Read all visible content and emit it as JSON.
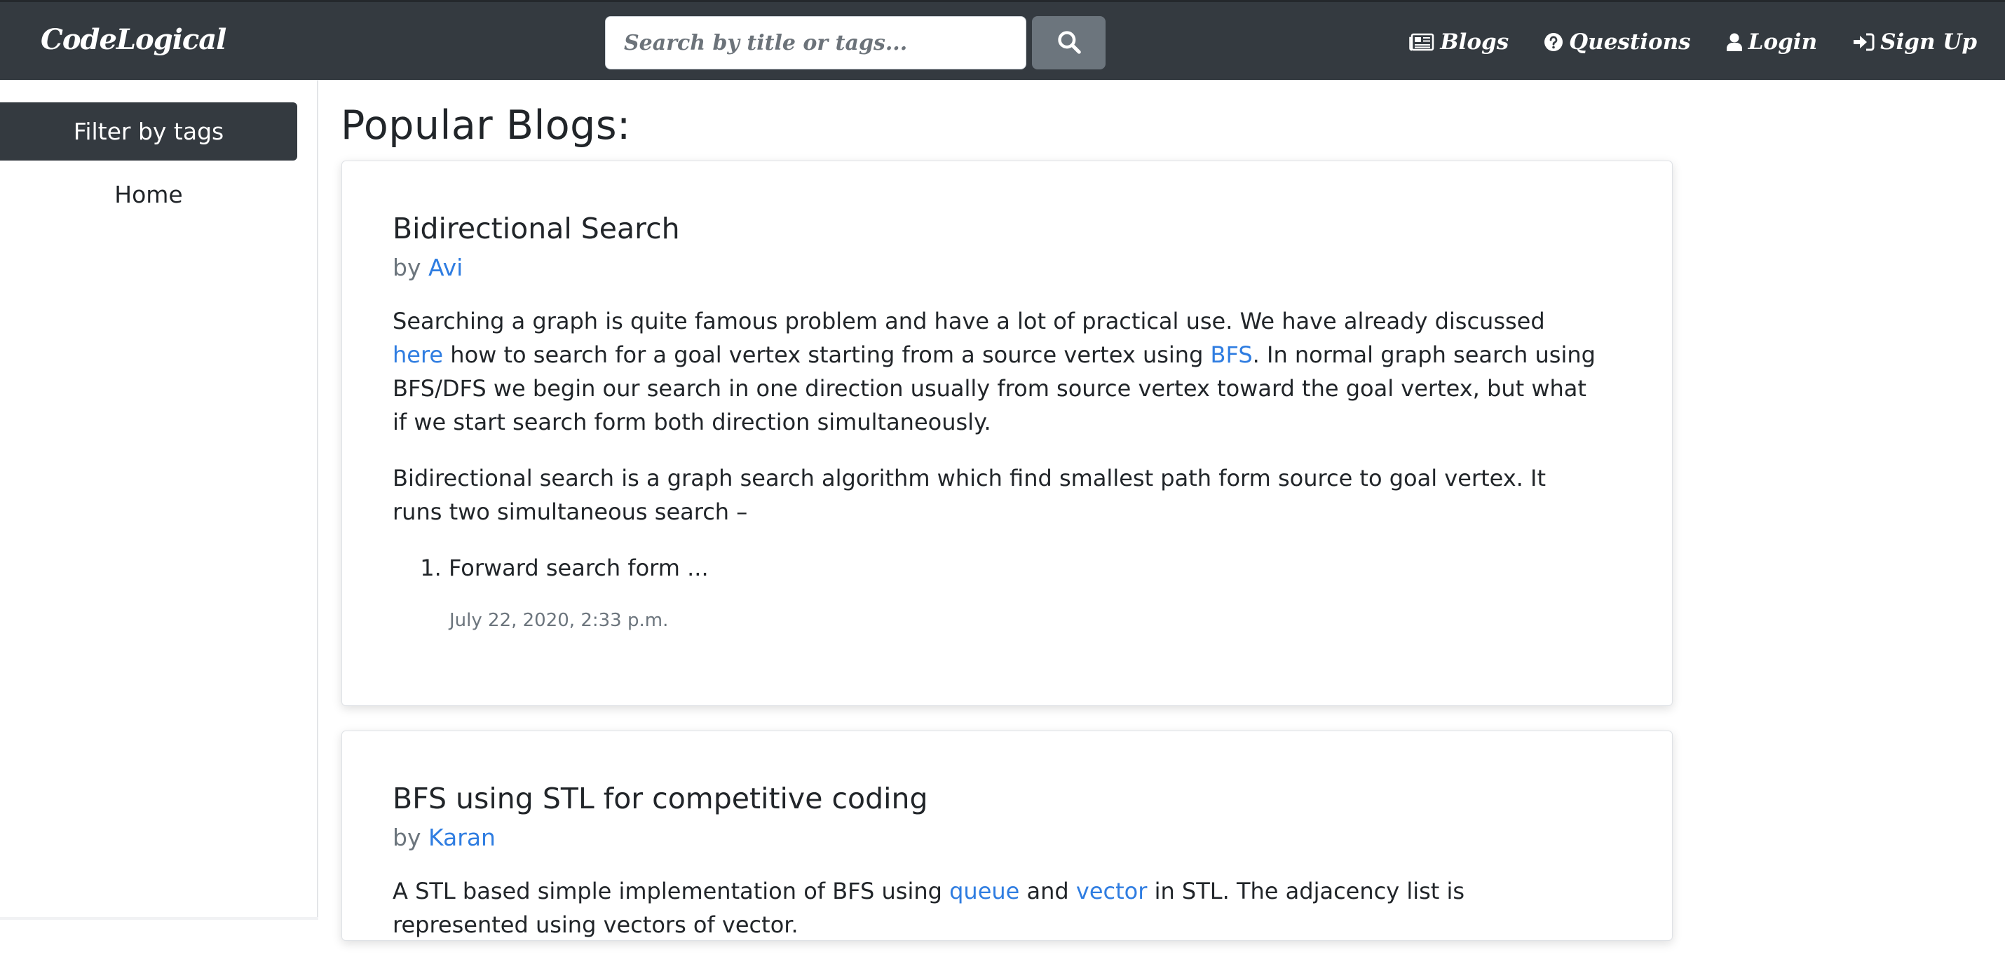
{
  "navbar": {
    "brand": "CodeLogical",
    "search_placeholder": "Search by title or tags...",
    "links": [
      {
        "label": "Blogs",
        "icon": "newspaper-icon"
      },
      {
        "label": "Questions",
        "icon": "question-circle-icon"
      },
      {
        "label": "Login",
        "icon": "user-icon"
      },
      {
        "label": "Sign Up",
        "icon": "sign-in-icon"
      }
    ]
  },
  "sidebar": {
    "filter_label": "Filter by tags",
    "home_label": "Home"
  },
  "main": {
    "title": "Popular Blogs:",
    "posts": [
      {
        "title": "Bidirectional Search",
        "by": "by",
        "author": "Avi",
        "p1_a": "Searching a graph is quite famous problem and have a lot of practical use. We have already discussed ",
        "p1_link1": "here",
        "p1_b": " how to search for a goal vertex starting from a source vertex using ",
        "p1_link2": "BFS",
        "p1_c": ". In normal graph search using BFS/DFS we begin our search in one direction usually from source vertex toward the goal vertex, but what if we start search form both direction simultaneously.",
        "p2": "Bidirectional search is a graph search algorithm which find smallest path form source to goal vertex. It runs two simultaneous search –",
        "list_item": "Forward search form ...",
        "date": "July 22, 2020, 2:33 p.m."
      },
      {
        "title": "BFS using STL for competitive coding",
        "by": "by",
        "author": "Karan",
        "p1_a": "A STL based simple implementation of BFS using ",
        "p1_link1": "queue",
        "p1_b": " and ",
        "p1_link2": "vector",
        "p1_c": " in STL. The adjacency list is represented using vectors of vector."
      }
    ]
  },
  "colors": {
    "navbar_bg": "#343a40",
    "search_button_bg": "#6c757d",
    "link": "#2f7de1",
    "text": "#212529",
    "muted": "#6c757d"
  }
}
